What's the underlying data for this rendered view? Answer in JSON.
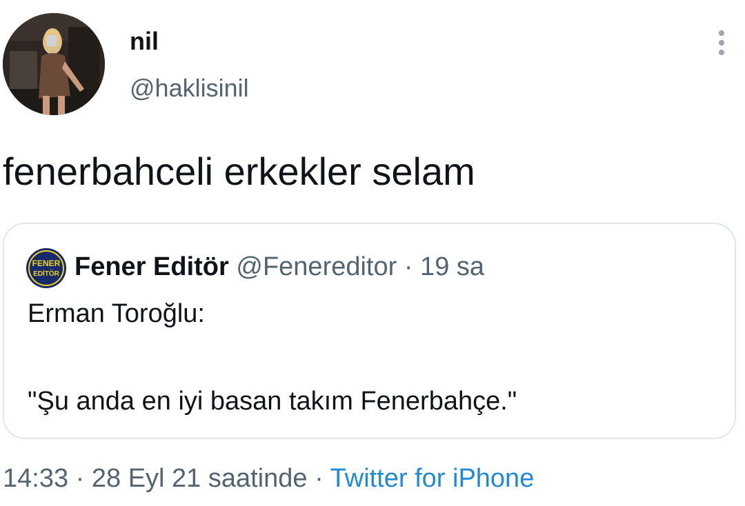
{
  "author": {
    "display_name": "nil",
    "username": "@haklisinil"
  },
  "tweet": {
    "text": "fenerbahceli erkekler selam"
  },
  "quoted_tweet": {
    "display_name": "Fener Editör",
    "username": "@Fenereditor",
    "separator": "·",
    "time": "19 sa",
    "logo_text_top": "FENER",
    "logo_text_bottom": "EDİTÖR",
    "line1": "Erman Toroğlu:",
    "line2": "\"Şu anda en iyi basan takım Fenerbahçe.\""
  },
  "meta": {
    "time": "14:33",
    "separator1": "·",
    "date": "28 Eyl 21 saatinde",
    "separator2": "·",
    "source": "Twitter for iPhone"
  },
  "icons": {
    "more": "more-vertical-icon"
  },
  "colors": {
    "text_primary": "#0f1419",
    "text_secondary": "#536471",
    "link": "#1f8ad6",
    "border": "#e1e6ea"
  }
}
